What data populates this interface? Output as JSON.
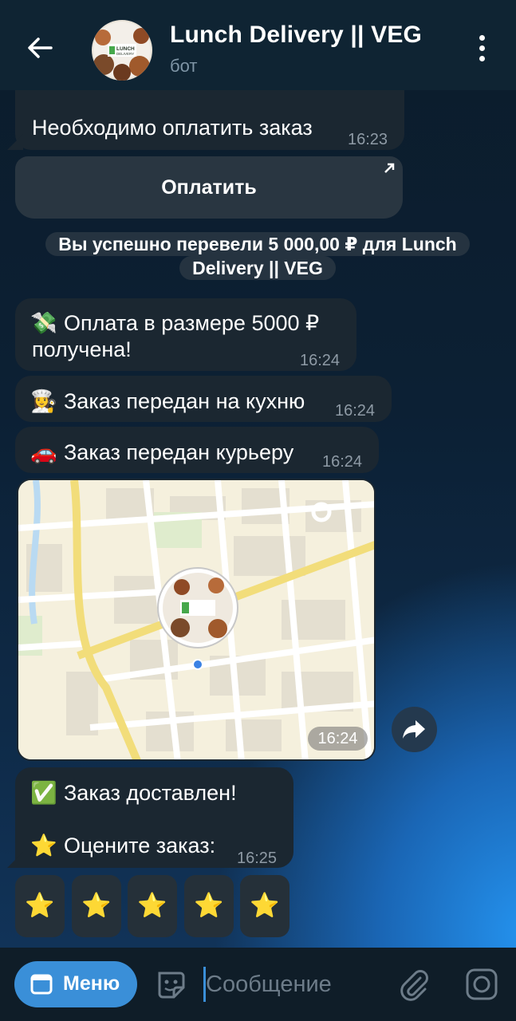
{
  "header": {
    "title": "Lunch Delivery || VEG",
    "subtitle": "бот",
    "avatar_text_1": "LUNCH",
    "avatar_text_2": "DELIVERY"
  },
  "messages": {
    "m1": {
      "text": "Необходимо оплатить заказ",
      "time": "16:23"
    },
    "pay_button": "Оплатить",
    "service": "Вы успешно перевели 5 000,00 ₽ для Lunch Delivery || VEG",
    "m2": {
      "emoji": "💸",
      "line1": "Оплата в размере 5000 ₽",
      "line2": "получена!",
      "time": "16:24"
    },
    "m3": {
      "emoji": "👩‍🍳",
      "text": "Заказ передан на кухню",
      "time": "16:24"
    },
    "m4": {
      "emoji": "🚗",
      "text": "Заказ передан курьеру",
      "time": "16:24"
    },
    "map": {
      "time": "16:24"
    },
    "m5": {
      "emoji1": "✅",
      "line1": "Заказ доставлен!",
      "emoji2": "⭐",
      "line2": "Оцените заказ:",
      "time": "16:25"
    }
  },
  "rating_buttons": [
    "⭐",
    "⭐",
    "⭐",
    "⭐",
    "⭐"
  ],
  "composer": {
    "menu_label": "Меню",
    "placeholder": "Сообщение"
  },
  "colors": {
    "accent": "#3a8fd8",
    "bubble": "#1b2731",
    "header": "#0f2433"
  }
}
